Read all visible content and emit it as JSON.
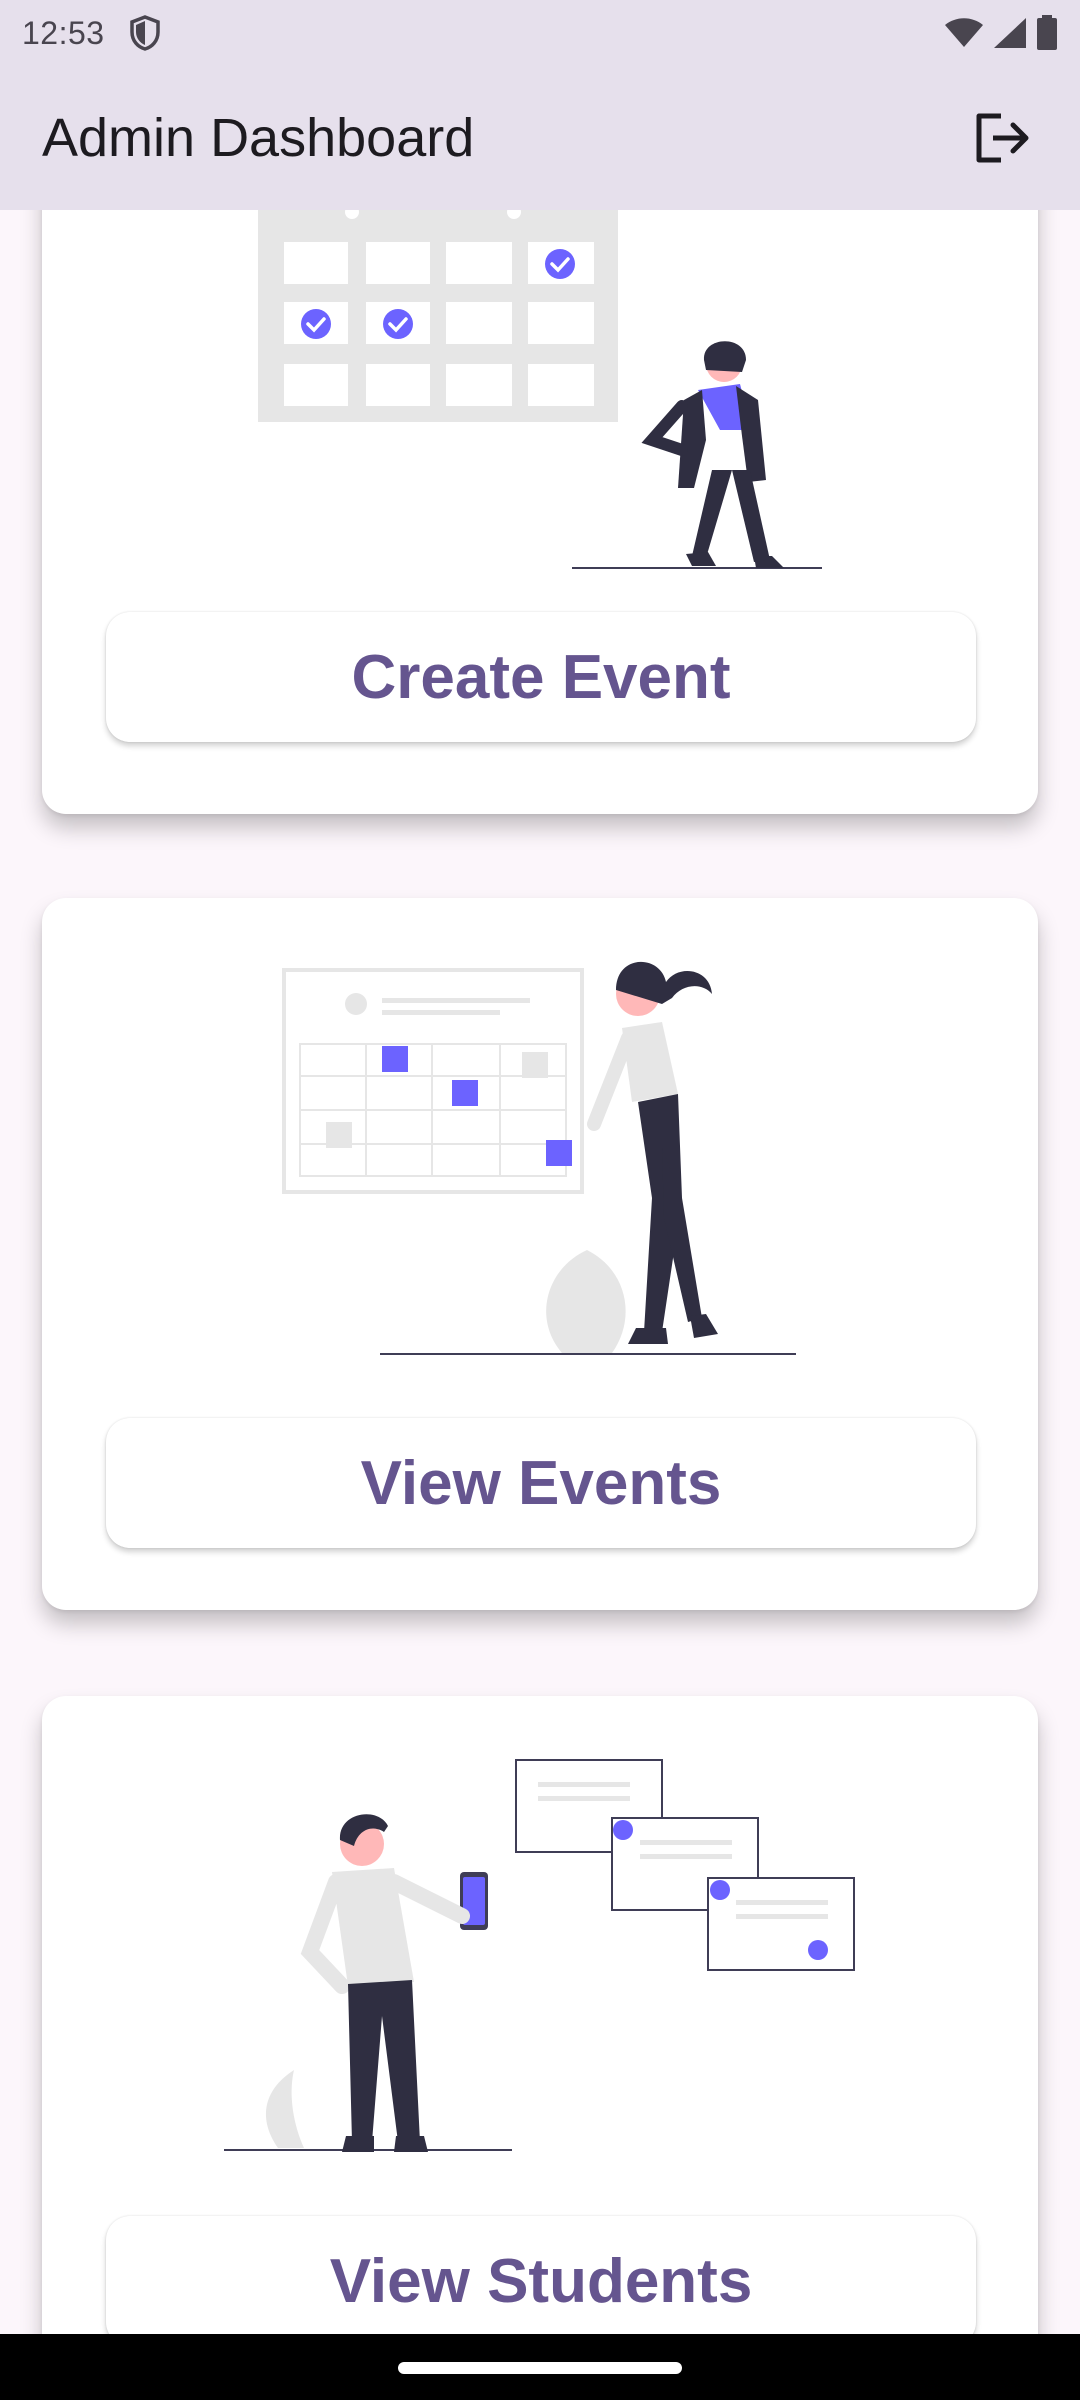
{
  "status_bar": {
    "time": "12:53",
    "icons": [
      "shield-icon",
      "wifi-icon",
      "signal-icon",
      "battery-icon"
    ]
  },
  "app_bar": {
    "title": "Admin Dashboard",
    "logout_icon": "logout-icon"
  },
  "cards": [
    {
      "illustration": "calendar-illustration",
      "button_label": "Create Event"
    },
    {
      "illustration": "schedule-board-illustration",
      "button_label": "View Events"
    },
    {
      "illustration": "person-with-phone-illustration",
      "button_label": "View Students"
    }
  ],
  "colors": {
    "app_bar_bg": "#e6e0ec",
    "page_bg": "#fcf6fb",
    "button_text": "#65558f",
    "accent": "#6c63ff",
    "ink": "#2f2e41"
  }
}
